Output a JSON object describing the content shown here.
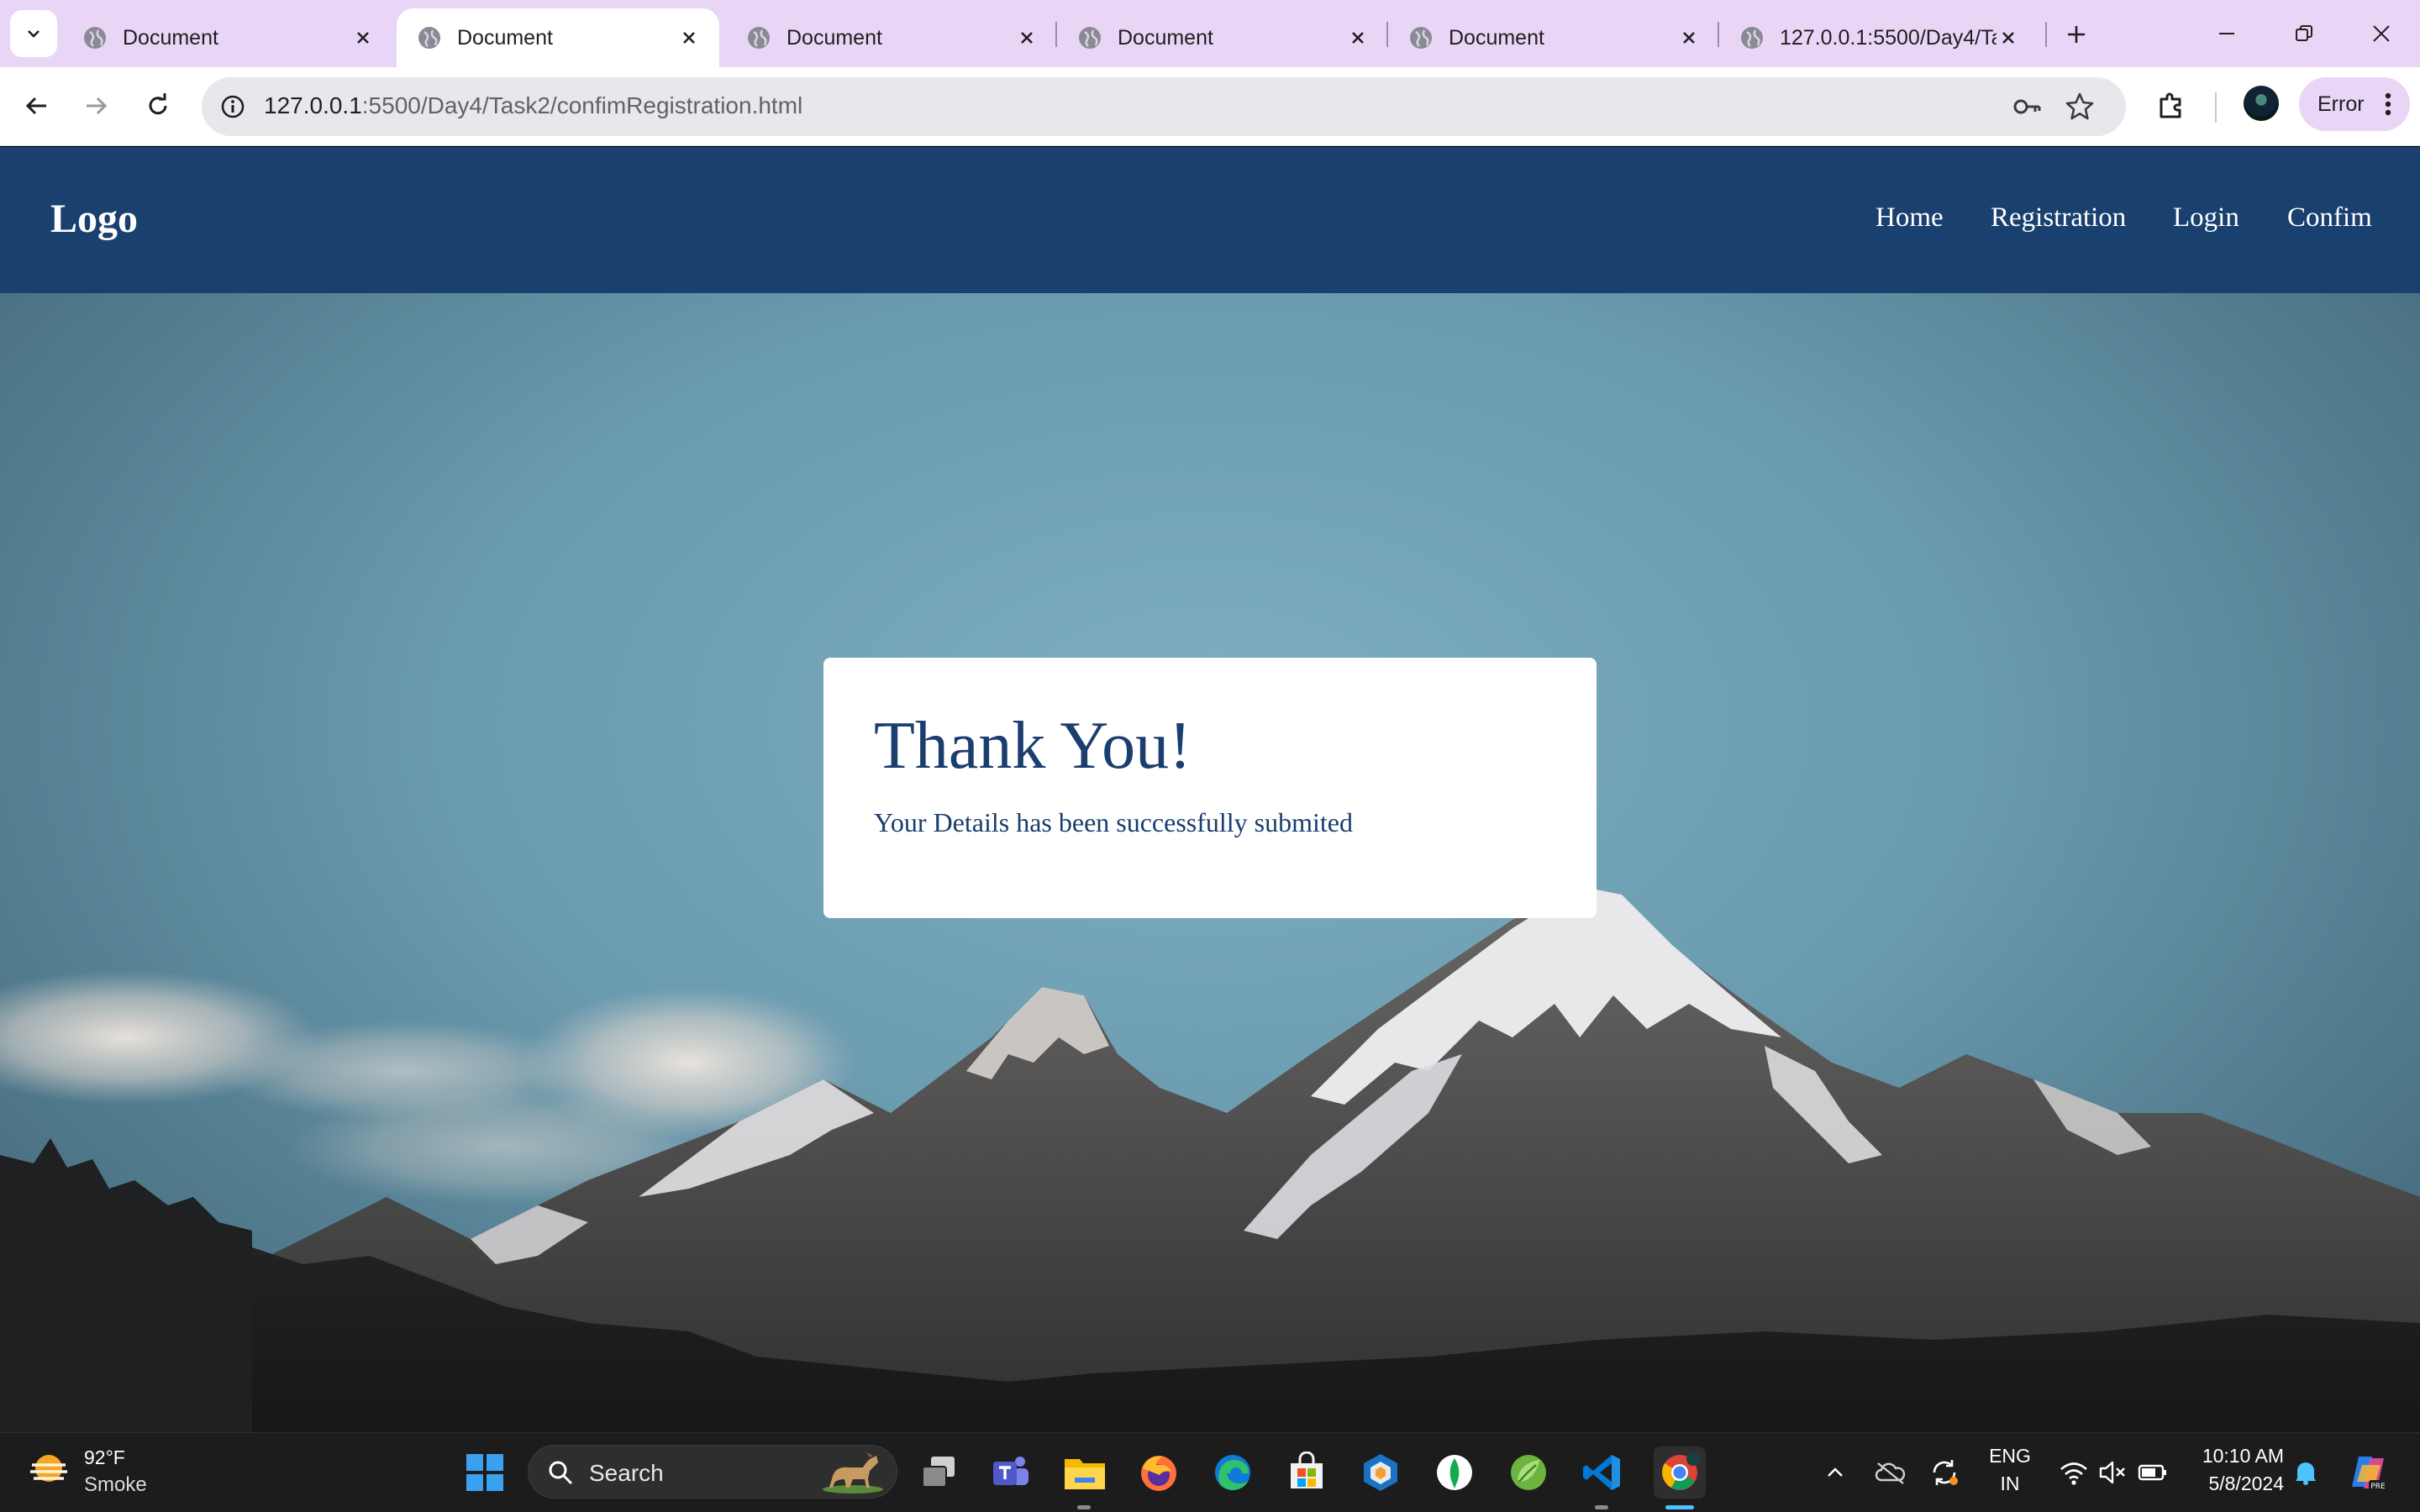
{
  "browser": {
    "tabs": [
      {
        "title": "Document",
        "active": false
      },
      {
        "title": "Document",
        "active": true
      },
      {
        "title": "Document",
        "active": false
      },
      {
        "title": "Document",
        "active": false
      },
      {
        "title": "Document",
        "active": false
      },
      {
        "title": "127.0.0.1:5500/Day4/Ta",
        "active": false
      }
    ],
    "url_host": "127.0.0.1",
    "url_rest": ":5500/Day4/Task2/confimRegistration.html",
    "profile_label": "Error",
    "accent": "#e9d6f7"
  },
  "page": {
    "logo": "Logo",
    "nav": [
      "Home",
      "Registration",
      "Login",
      "Confim"
    ],
    "card": {
      "title": "Thank You!",
      "message": "Your Details has been successfully submited"
    },
    "navbar_color": "#1a4070",
    "text_color": "#1a3e6e"
  },
  "taskbar": {
    "weather": {
      "temp": "92°F",
      "condition": "Smoke"
    },
    "search_placeholder": "Search",
    "apps": [
      "start-icon",
      "task-view-icon",
      "teams-icon",
      "file-explorer-icon",
      "firefox-icon",
      "edge-icon",
      "store-icon",
      "virtualbox-icon",
      "mongodb-compass-icon",
      "spring-tools-icon",
      "vscode-icon",
      "chrome-icon"
    ],
    "tray": {
      "lang_top": "ENG",
      "lang_bottom": "IN",
      "time": "10:10 AM",
      "date": "5/8/2024"
    }
  }
}
